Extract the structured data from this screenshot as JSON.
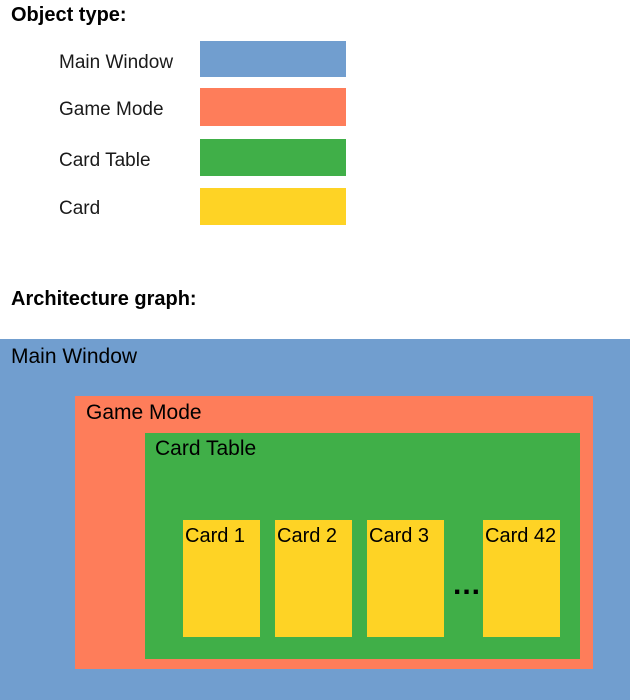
{
  "legend": {
    "title": "Object type:",
    "items": [
      {
        "label": "Main Window",
        "color": "#719ecf"
      },
      {
        "label": "Game Mode",
        "color": "#fe7d5a"
      },
      {
        "label": "Card Table",
        "color": "#40af48"
      },
      {
        "label": "Card",
        "color": "#fed325"
      }
    ]
  },
  "architecture": {
    "title": "Architecture graph:",
    "main_window": {
      "label": "Main Window",
      "color": "#719ecf"
    },
    "game_mode": {
      "label": "Game Mode",
      "color": "#fe7d5a"
    },
    "card_table": {
      "label": "Card Table",
      "color": "#40af48"
    },
    "cards": [
      {
        "label": "Card 1"
      },
      {
        "label": "Card 2"
      },
      {
        "label": "Card 3"
      },
      {
        "label": "Card 42"
      }
    ],
    "card_color": "#fed325",
    "ellipsis": "..."
  }
}
